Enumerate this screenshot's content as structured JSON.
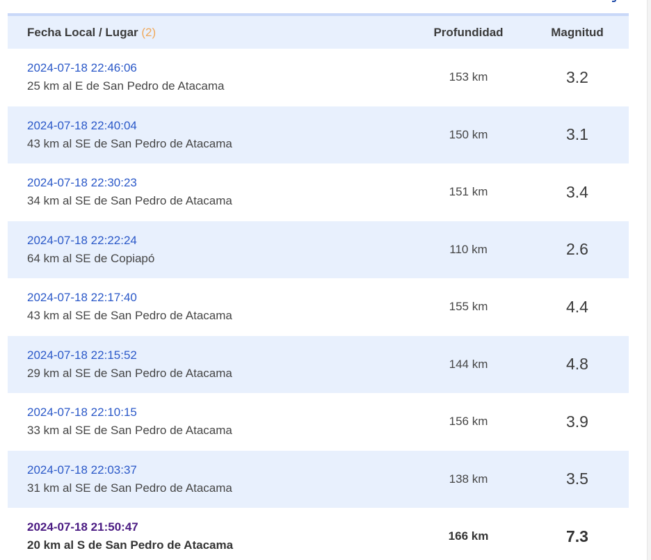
{
  "table": {
    "header": {
      "col_fecha": "Fecha Local / Lugar",
      "count": "(2)",
      "col_profundidad": "Profundidad",
      "col_magnitud": "Magnitud"
    },
    "rows": [
      {
        "datetime": "2024-07-18 22:46:06",
        "place": "25 km al E de San Pedro de Atacama",
        "depth": "153 km",
        "magnitude": "3.2"
      },
      {
        "datetime": "2024-07-18 22:40:04",
        "place": "43 km al SE de San Pedro de Atacama",
        "depth": "150 km",
        "magnitude": "3.1"
      },
      {
        "datetime": "2024-07-18 22:30:23",
        "place": "34 km al SE de San Pedro de Atacama",
        "depth": "151 km",
        "magnitude": "3.4"
      },
      {
        "datetime": "2024-07-18 22:22:24",
        "place": "64 km al SE de Copiapó",
        "depth": "110 km",
        "magnitude": "2.6"
      },
      {
        "datetime": "2024-07-18 22:17:40",
        "place": "43 km al SE de San Pedro de Atacama",
        "depth": "155 km",
        "magnitude": "4.4"
      },
      {
        "datetime": "2024-07-18 22:15:52",
        "place": "29 km al SE de San Pedro de Atacama",
        "depth": "144 km",
        "magnitude": "4.8"
      },
      {
        "datetime": "2024-07-18 22:10:15",
        "place": "33 km al SE de San Pedro de Atacama",
        "depth": "156 km",
        "magnitude": "3.9"
      },
      {
        "datetime": "2024-07-18 22:03:37",
        "place": "31 km al SE de San Pedro de Atacama",
        "depth": "138 km",
        "magnitude": "3.5"
      },
      {
        "datetime": "2024-07-18 21:50:47",
        "place": "20 km al S de San Pedro de Atacama",
        "depth": "166 km",
        "magnitude": "7.3",
        "emphasized": true
      }
    ]
  },
  "colors": {
    "header_bg": "#e8f0fd",
    "link": "#2a58c8",
    "visited_link": "#4a1a82",
    "count_accent": "#f0a85a"
  }
}
